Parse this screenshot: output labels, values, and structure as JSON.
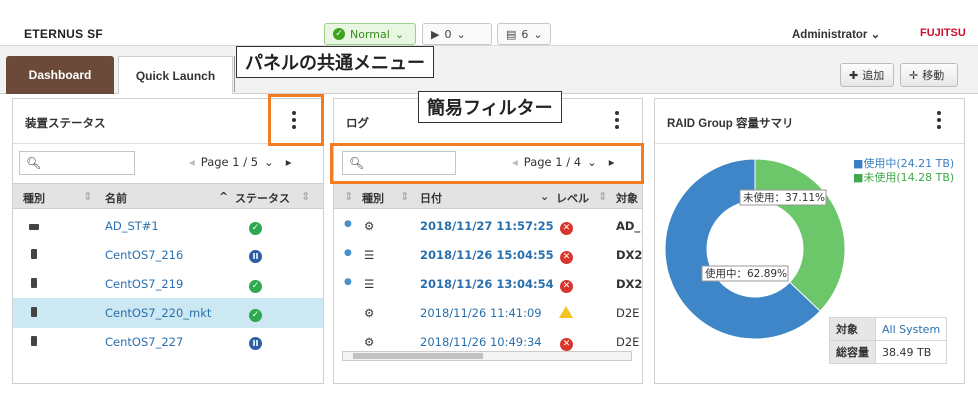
{
  "header": {
    "brand": "ETERNUS SF",
    "status_normal": "Normal",
    "alert_count": "0",
    "job_count": "6",
    "user": "Administrator",
    "vendor": "FUJITSU"
  },
  "tabs": [
    {
      "label": "Dashboard",
      "active": true
    },
    {
      "label": "Quick Launch",
      "active": false
    }
  ],
  "toolbar": {
    "add_label": "追加",
    "move_label": "移動"
  },
  "annotations": {
    "panel_menu": "パネルの共通メニュー",
    "simple_filter": "簡易フィルター"
  },
  "panel_status": {
    "title": "装置ステータス",
    "pager": "Page 1 / 5",
    "columns": [
      "種別",
      "名前",
      "ステータス"
    ],
    "rows": [
      {
        "name": "AD_ST#1",
        "status": "normal",
        "selected": false
      },
      {
        "name": "CentOS7_216",
        "status": "paused",
        "selected": false
      },
      {
        "name": "CentOS7_219",
        "status": "normal",
        "selected": false
      },
      {
        "name": "CentOS7_220_mkt",
        "status": "normal",
        "selected": true
      },
      {
        "name": "CentOS7_227",
        "status": "paused",
        "selected": false
      }
    ]
  },
  "panel_log": {
    "title": "ログ",
    "pager": "Page 1 / 4",
    "columns": [
      "種別",
      "日付",
      "レベル",
      "対象"
    ],
    "rows": [
      {
        "date": "2018/11/27 11:57:25",
        "level": "error",
        "target": "AD_",
        "bold": true
      },
      {
        "date": "2018/11/26 15:04:55",
        "level": "error",
        "target": "DX2",
        "bold": true
      },
      {
        "date": "2018/11/26 13:04:54",
        "level": "error",
        "target": "DX2",
        "bold": true
      },
      {
        "date": "2018/11/26 11:41:09",
        "level": "warning",
        "target": "D2E",
        "bold": false
      },
      {
        "date": "2018/11/26 10:49:34",
        "level": "error",
        "target": "D2E",
        "bold": false
      }
    ]
  },
  "panel_raid": {
    "title": "RAID Group 容量サマリ",
    "legend_used": "■使用中(24.21 TB)",
    "legend_unused": "■未使用(14.28 TB)",
    "label_used": "使用中：62.89%",
    "label_unused": "未使用：37.11%",
    "target_key": "対象",
    "target_value": "All System",
    "total_key": "総容量",
    "total_value": "38.49 TB",
    "colors": {
      "used": "#3f86c9",
      "unused": "#6cc66a"
    }
  },
  "chart_data": {
    "type": "pie",
    "title": "RAID Group 容量サマリ",
    "labels": [
      "使用中",
      "未使用"
    ],
    "values": [
      62.89,
      37.11
    ],
    "capacity_tb": [
      24.21,
      14.28
    ],
    "total_tb": 38.49,
    "donut": true
  }
}
